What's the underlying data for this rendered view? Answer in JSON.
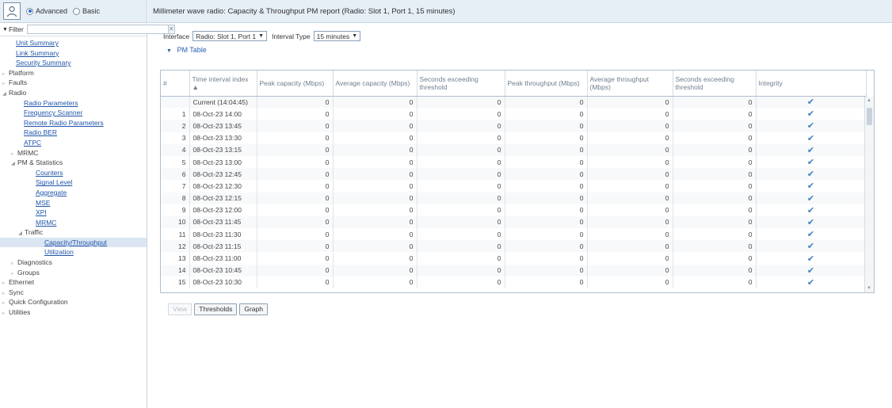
{
  "mode": {
    "advanced_label": "Advanced",
    "basic_label": "Basic",
    "selected": "Advanced"
  },
  "filter": {
    "label": "Filter",
    "value": ""
  },
  "nav": [
    {
      "label": "Unit Summary",
      "level": 1,
      "link": true,
      "expander": ""
    },
    {
      "label": "Link Summary",
      "level": 1,
      "link": true,
      "expander": ""
    },
    {
      "label": "Security Summary",
      "level": 1,
      "link": true,
      "expander": ""
    },
    {
      "label": "Platform",
      "level": 0,
      "link": false,
      "expander": "▹"
    },
    {
      "label": "Faults",
      "level": 0,
      "link": false,
      "expander": "▹"
    },
    {
      "label": "Radio",
      "level": 0,
      "link": false,
      "expander": "◢"
    },
    {
      "label": "Radio Parameters",
      "level": 2,
      "link": true,
      "expander": ""
    },
    {
      "label": "Frequency Scanner",
      "level": 2,
      "link": true,
      "expander": ""
    },
    {
      "label": "Remote Radio Parameters",
      "level": 2,
      "link": true,
      "expander": ""
    },
    {
      "label": "Radio BER",
      "level": 2,
      "link": true,
      "expander": ""
    },
    {
      "label": "ATPC",
      "level": 2,
      "link": true,
      "expander": ""
    },
    {
      "label": "MRMC",
      "level": 1,
      "link": false,
      "expander": "▹"
    },
    {
      "label": "PM & Statistics",
      "level": 1,
      "link": false,
      "expander": "◢"
    },
    {
      "label": "Counters",
      "level": 3,
      "link": true,
      "expander": ""
    },
    {
      "label": "Signal Level",
      "level": 3,
      "link": true,
      "expander": ""
    },
    {
      "label": "Aggregate",
      "level": 3,
      "link": true,
      "expander": ""
    },
    {
      "label": "MSE",
      "level": 3,
      "link": true,
      "expander": ""
    },
    {
      "label": "XPI",
      "level": 3,
      "link": true,
      "expander": ""
    },
    {
      "label": "MRMC",
      "level": 3,
      "link": true,
      "expander": ""
    },
    {
      "label": "Traffic",
      "level": 2,
      "link": false,
      "expander": "◢"
    },
    {
      "label": "Capacity/Throughput",
      "level": 4,
      "link": true,
      "expander": "",
      "active": true
    },
    {
      "label": "Utilization",
      "level": 4,
      "link": true,
      "expander": ""
    },
    {
      "label": "Diagnostics",
      "level": 1,
      "link": false,
      "expander": "▹"
    },
    {
      "label": "Groups",
      "level": 1,
      "link": false,
      "expander": "▹"
    },
    {
      "label": "Ethernet",
      "level": 0,
      "link": false,
      "expander": "▹"
    },
    {
      "label": "Sync",
      "level": 0,
      "link": false,
      "expander": "▹"
    },
    {
      "label": "Quick Configuration",
      "level": 0,
      "link": false,
      "expander": "▹"
    },
    {
      "label": "Utilities",
      "level": 0,
      "link": false,
      "expander": "▹"
    }
  ],
  "page": {
    "title": "Millimeter wave radio: Capacity & Throughput PM report (Radio: Slot 1, Port 1, 15 minutes)"
  },
  "controls": {
    "interface_label": "Interface",
    "interface_value": "Radio: Slot 1, Port 1",
    "interval_label": "Interval Type",
    "interval_value": "15 minutes"
  },
  "section": {
    "title": "PM Table"
  },
  "table": {
    "columns": [
      "#",
      "Time interval index ▲",
      "Peak capacity (Mbps)",
      "Average capacity (Mbps)",
      "Seconds exceeding threshold",
      "Peak throughput (Mbps)",
      "Average throughput (Mbps)",
      "Seconds exceeding threshold",
      "Integrity"
    ],
    "rows": [
      {
        "idx": "",
        "time": "Current (14:04:45)",
        "peak_cap": "0",
        "avg_cap": "0",
        "sec_cap": "0",
        "peak_thr": "0",
        "avg_thr": "0",
        "sec_thr": "0",
        "integrity": "✔"
      },
      {
        "idx": "1",
        "time": "08-Oct-23 14:00",
        "peak_cap": "0",
        "avg_cap": "0",
        "sec_cap": "0",
        "peak_thr": "0",
        "avg_thr": "0",
        "sec_thr": "0",
        "integrity": "✔"
      },
      {
        "idx": "2",
        "time": "08-Oct-23 13:45",
        "peak_cap": "0",
        "avg_cap": "0",
        "sec_cap": "0",
        "peak_thr": "0",
        "avg_thr": "0",
        "sec_thr": "0",
        "integrity": "✔"
      },
      {
        "idx": "3",
        "time": "08-Oct-23 13:30",
        "peak_cap": "0",
        "avg_cap": "0",
        "sec_cap": "0",
        "peak_thr": "0",
        "avg_thr": "0",
        "sec_thr": "0",
        "integrity": "✔"
      },
      {
        "idx": "4",
        "time": "08-Oct-23 13:15",
        "peak_cap": "0",
        "avg_cap": "0",
        "sec_cap": "0",
        "peak_thr": "0",
        "avg_thr": "0",
        "sec_thr": "0",
        "integrity": "✔"
      },
      {
        "idx": "5",
        "time": "08-Oct-23 13:00",
        "peak_cap": "0",
        "avg_cap": "0",
        "sec_cap": "0",
        "peak_thr": "0",
        "avg_thr": "0",
        "sec_thr": "0",
        "integrity": "✔"
      },
      {
        "idx": "6",
        "time": "08-Oct-23 12:45",
        "peak_cap": "0",
        "avg_cap": "0",
        "sec_cap": "0",
        "peak_thr": "0",
        "avg_thr": "0",
        "sec_thr": "0",
        "integrity": "✔"
      },
      {
        "idx": "7",
        "time": "08-Oct-23 12:30",
        "peak_cap": "0",
        "avg_cap": "0",
        "sec_cap": "0",
        "peak_thr": "0",
        "avg_thr": "0",
        "sec_thr": "0",
        "integrity": "✔"
      },
      {
        "idx": "8",
        "time": "08-Oct-23 12:15",
        "peak_cap": "0",
        "avg_cap": "0",
        "sec_cap": "0",
        "peak_thr": "0",
        "avg_thr": "0",
        "sec_thr": "0",
        "integrity": "✔"
      },
      {
        "idx": "9",
        "time": "08-Oct-23 12:00",
        "peak_cap": "0",
        "avg_cap": "0",
        "sec_cap": "0",
        "peak_thr": "0",
        "avg_thr": "0",
        "sec_thr": "0",
        "integrity": "✔"
      },
      {
        "idx": "10",
        "time": "08-Oct-23 11:45",
        "peak_cap": "0",
        "avg_cap": "0",
        "sec_cap": "0",
        "peak_thr": "0",
        "avg_thr": "0",
        "sec_thr": "0",
        "integrity": "✔"
      },
      {
        "idx": "11",
        "time": "08-Oct-23 11:30",
        "peak_cap": "0",
        "avg_cap": "0",
        "sec_cap": "0",
        "peak_thr": "0",
        "avg_thr": "0",
        "sec_thr": "0",
        "integrity": "✔"
      },
      {
        "idx": "12",
        "time": "08-Oct-23 11:15",
        "peak_cap": "0",
        "avg_cap": "0",
        "sec_cap": "0",
        "peak_thr": "0",
        "avg_thr": "0",
        "sec_thr": "0",
        "integrity": "✔"
      },
      {
        "idx": "13",
        "time": "08-Oct-23 11:00",
        "peak_cap": "0",
        "avg_cap": "0",
        "sec_cap": "0",
        "peak_thr": "0",
        "avg_thr": "0",
        "sec_thr": "0",
        "integrity": "✔"
      },
      {
        "idx": "14",
        "time": "08-Oct-23 10:45",
        "peak_cap": "0",
        "avg_cap": "0",
        "sec_cap": "0",
        "peak_thr": "0",
        "avg_thr": "0",
        "sec_thr": "0",
        "integrity": "✔"
      },
      {
        "idx": "15",
        "time": "08-Oct-23 10:30",
        "peak_cap": "0",
        "avg_cap": "0",
        "sec_cap": "0",
        "peak_thr": "0",
        "avg_thr": "0",
        "sec_thr": "0",
        "integrity": "✔"
      }
    ]
  },
  "buttons": {
    "view_label": "View",
    "thresholds_label": "Thresholds",
    "graph_label": "Graph"
  },
  "icons": {
    "avatar": "user-icon",
    "check": "checkmark-icon",
    "filter_clear": "clear-icon"
  },
  "colors": {
    "header_bg": "#e6eef6",
    "link": "#1f55a8",
    "accent": "#2a6fc9",
    "check": "#3d7fc4"
  }
}
